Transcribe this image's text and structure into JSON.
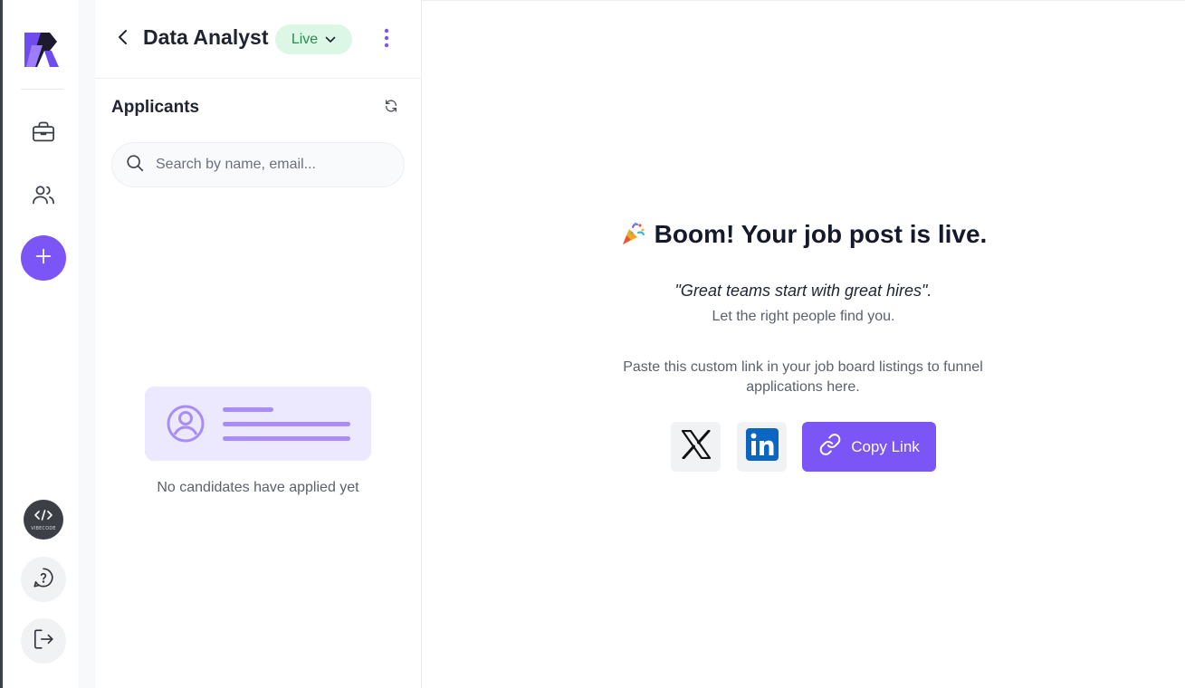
{
  "sidebar": {
    "logo_icon": "r-logo-icon",
    "nav": [
      {
        "name": "jobs",
        "icon": "briefcase-icon"
      },
      {
        "name": "candidates",
        "icon": "users-icon"
      },
      {
        "name": "add",
        "icon": "plus-icon"
      }
    ],
    "bottom": [
      {
        "name": "vibecode",
        "icon": "code-icon",
        "label": "VIBECODE"
      },
      {
        "name": "help",
        "icon": "help-circle-icon"
      },
      {
        "name": "logout",
        "icon": "logout-icon"
      }
    ],
    "accent_color": "#7b55f5"
  },
  "panel": {
    "job_title": "Data Analyst",
    "status": "Live",
    "status_color": "#2b8a4f",
    "applicants_heading": "Applicants",
    "search_placeholder": "Search by name, email...",
    "search_value": "",
    "empty_message": "No candidates have applied yet"
  },
  "main": {
    "headline": "Boom! Your job post is live.",
    "headline_emoji": "🎉",
    "quote": "\"Great teams start with great hires\".",
    "subtext": "Let the right people find you.",
    "instruction": "Paste this custom link in your job board listings to funnel applications here.",
    "share": [
      {
        "name": "x",
        "icon": "x-logo-icon"
      },
      {
        "name": "linkedin",
        "icon": "linkedin-logo-icon"
      }
    ],
    "copy_link_label": "Copy Link"
  }
}
